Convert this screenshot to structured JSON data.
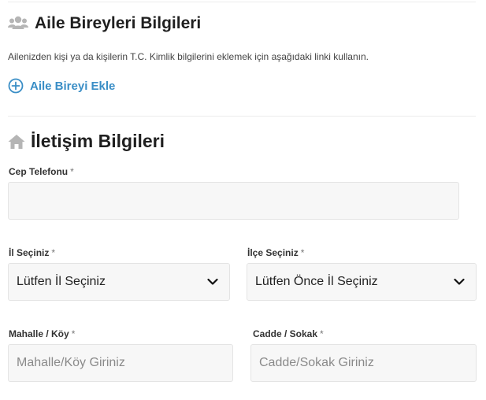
{
  "family": {
    "title": "Aile Bireyleri Bilgileri",
    "icon": "users-icon",
    "description": "Ailenizden kişi ya da kişilerin T.C. Kimlik bilgilerini eklemek için aşağıdaki linki kullanın.",
    "add_link": "Aile Bireyi Ekle",
    "add_icon": "plus-circle-icon"
  },
  "contact": {
    "title": "İletişim Bilgileri",
    "icon": "home-icon",
    "phone": {
      "label": "Cep Telefonu",
      "required": "*",
      "value": ""
    },
    "province": {
      "label": "İl Seçiniz",
      "required": "*",
      "selected": "Lütfen İl Seçiniz"
    },
    "district": {
      "label": "İlçe Seçiniz",
      "required": "*",
      "selected": "Lütfen Önce İl Seçiniz"
    },
    "neighborhood": {
      "label": "Mahalle / Köy",
      "required": "*",
      "placeholder": "Mahalle/Köy Giriniz"
    },
    "street": {
      "label": "Cadde / Sokak",
      "required": "*",
      "placeholder": "Cadde/Sokak Giriniz"
    }
  },
  "colors": {
    "link": "#3a8ec6",
    "icon": "#b5b5b5",
    "field_bg": "#f7f7f7"
  }
}
